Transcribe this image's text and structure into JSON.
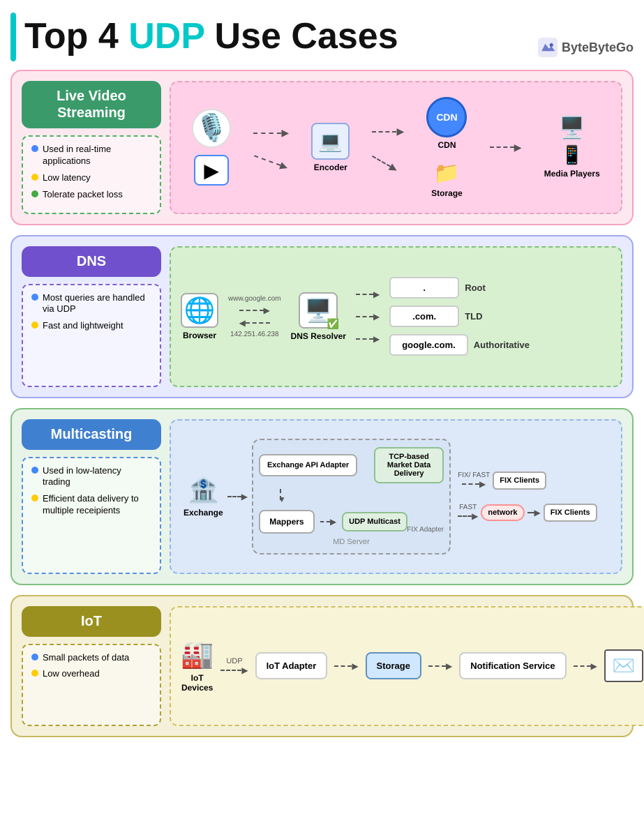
{
  "header": {
    "title_part1": "Top 4 ",
    "title_udp": "UDP",
    "title_part2": " Use Cases",
    "brand_name": "ByteByteGo"
  },
  "sections": [
    {
      "id": "streaming",
      "label": "Live Video Streaming",
      "label_color": "green",
      "card_bg": "pink",
      "bullets": [
        {
          "color": "blue",
          "text": "Used in real-time applications"
        },
        {
          "color": "yellow",
          "text": "Low latency"
        },
        {
          "color": "green",
          "text": "Tolerate packet loss"
        }
      ],
      "diagram": {
        "sources": [
          "🎙️",
          "▶️"
        ],
        "encoder_label": "Encoder",
        "storage_label": "Storage",
        "cdn_label": "CDN",
        "media_players_label": "Media Players"
      }
    },
    {
      "id": "dns",
      "label": "DNS",
      "label_color": "purple",
      "card_bg": "blue",
      "bullets": [
        {
          "color": "blue",
          "text": "Most queries are handled via UDP"
        },
        {
          "color": "yellow",
          "text": "Fast and lightweight"
        }
      ],
      "diagram": {
        "browser_label": "Browser",
        "query_url": "www.google.com",
        "response_ip": "142.251.46.238",
        "resolver_label": "DNS Resolver",
        "levels": [
          {
            "name": ".",
            "label": "Root"
          },
          {
            "name": ".com.",
            "label": "TLD"
          },
          {
            "name": "google.com.",
            "label": "Authoritative"
          }
        ]
      }
    },
    {
      "id": "multicast",
      "label": "Multicasting",
      "label_color": "blue",
      "card_bg": "lightblue",
      "bullets": [
        {
          "color": "blue",
          "text": "Used in low-latency trading"
        },
        {
          "color": "yellow",
          "text": "Efficient data delivery to multiple receipients"
        }
      ],
      "diagram": {
        "exchange_label": "Exchange",
        "exchange_api_label": "Exchange API Adapter",
        "mappers_label": "Mappers",
        "tcp_label": "TCP-based Market Data Delivery",
        "fix_adapter_label": "FIX Adapter",
        "udp_multicast_label": "UDP Multicast",
        "md_server_label": "MD Server",
        "fix_fast_label": "FIX/ FAST",
        "fast_label": "FAST",
        "fix_clients_label_1": "FIX Clients",
        "fix_clients_label_2": "FIX Clients",
        "network_label": "network"
      }
    },
    {
      "id": "iot",
      "label": "IoT",
      "label_color": "olive",
      "card_bg": "lightyellow",
      "bullets": [
        {
          "color": "blue",
          "text": "Small packets of data"
        },
        {
          "color": "yellow",
          "text": "Low overhead"
        }
      ],
      "diagram": {
        "iot_devices_label": "IoT Devices",
        "udp_label": "UDP",
        "iot_adapter_label": "IoT Adapter",
        "storage_label": "Storage",
        "notification_label": "Notification Service",
        "email_icon": "✉️"
      }
    }
  ]
}
